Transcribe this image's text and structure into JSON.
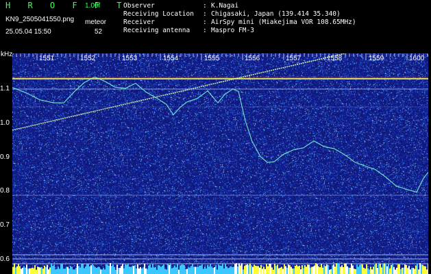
{
  "header": {
    "brand": "H R O F F T",
    "version": "1.00f",
    "filename": "KN9_2505041550.png",
    "meteor_label": "meteor",
    "timestamp": "25.05.04 15:50",
    "meteor_count": "52"
  },
  "info": [
    {
      "label": "Observer",
      "value": "K.Nagai"
    },
    {
      "label": "Receiving Location",
      "value": "Chigasaki, Japan (139.414 35.340)"
    },
    {
      "label": "Receiver",
      "value": "AirSpy mini (Miakejima VOR 108.65MHz)"
    },
    {
      "label": "Receiving antenna",
      "value": "Maspro FM-3"
    }
  ],
  "spectrogram": {
    "y_unit": "kHz",
    "x_ticks": [
      "1551",
      "1552",
      "1553",
      "1554",
      "1555",
      "1556",
      "1557",
      "1558",
      "1559",
      "1600"
    ],
    "y_ticks": [
      "1.1",
      "1.0",
      "0.9",
      "0.8",
      "0.7",
      "0.6"
    ],
    "ylim": [
      0.58,
      1.22
    ],
    "colors": {
      "background": "#10187a",
      "carrier": "#f2e650",
      "trace": "#7affd6",
      "reflection": "#d8ffb0",
      "bottom_band": "#ffff3c"
    }
  }
}
